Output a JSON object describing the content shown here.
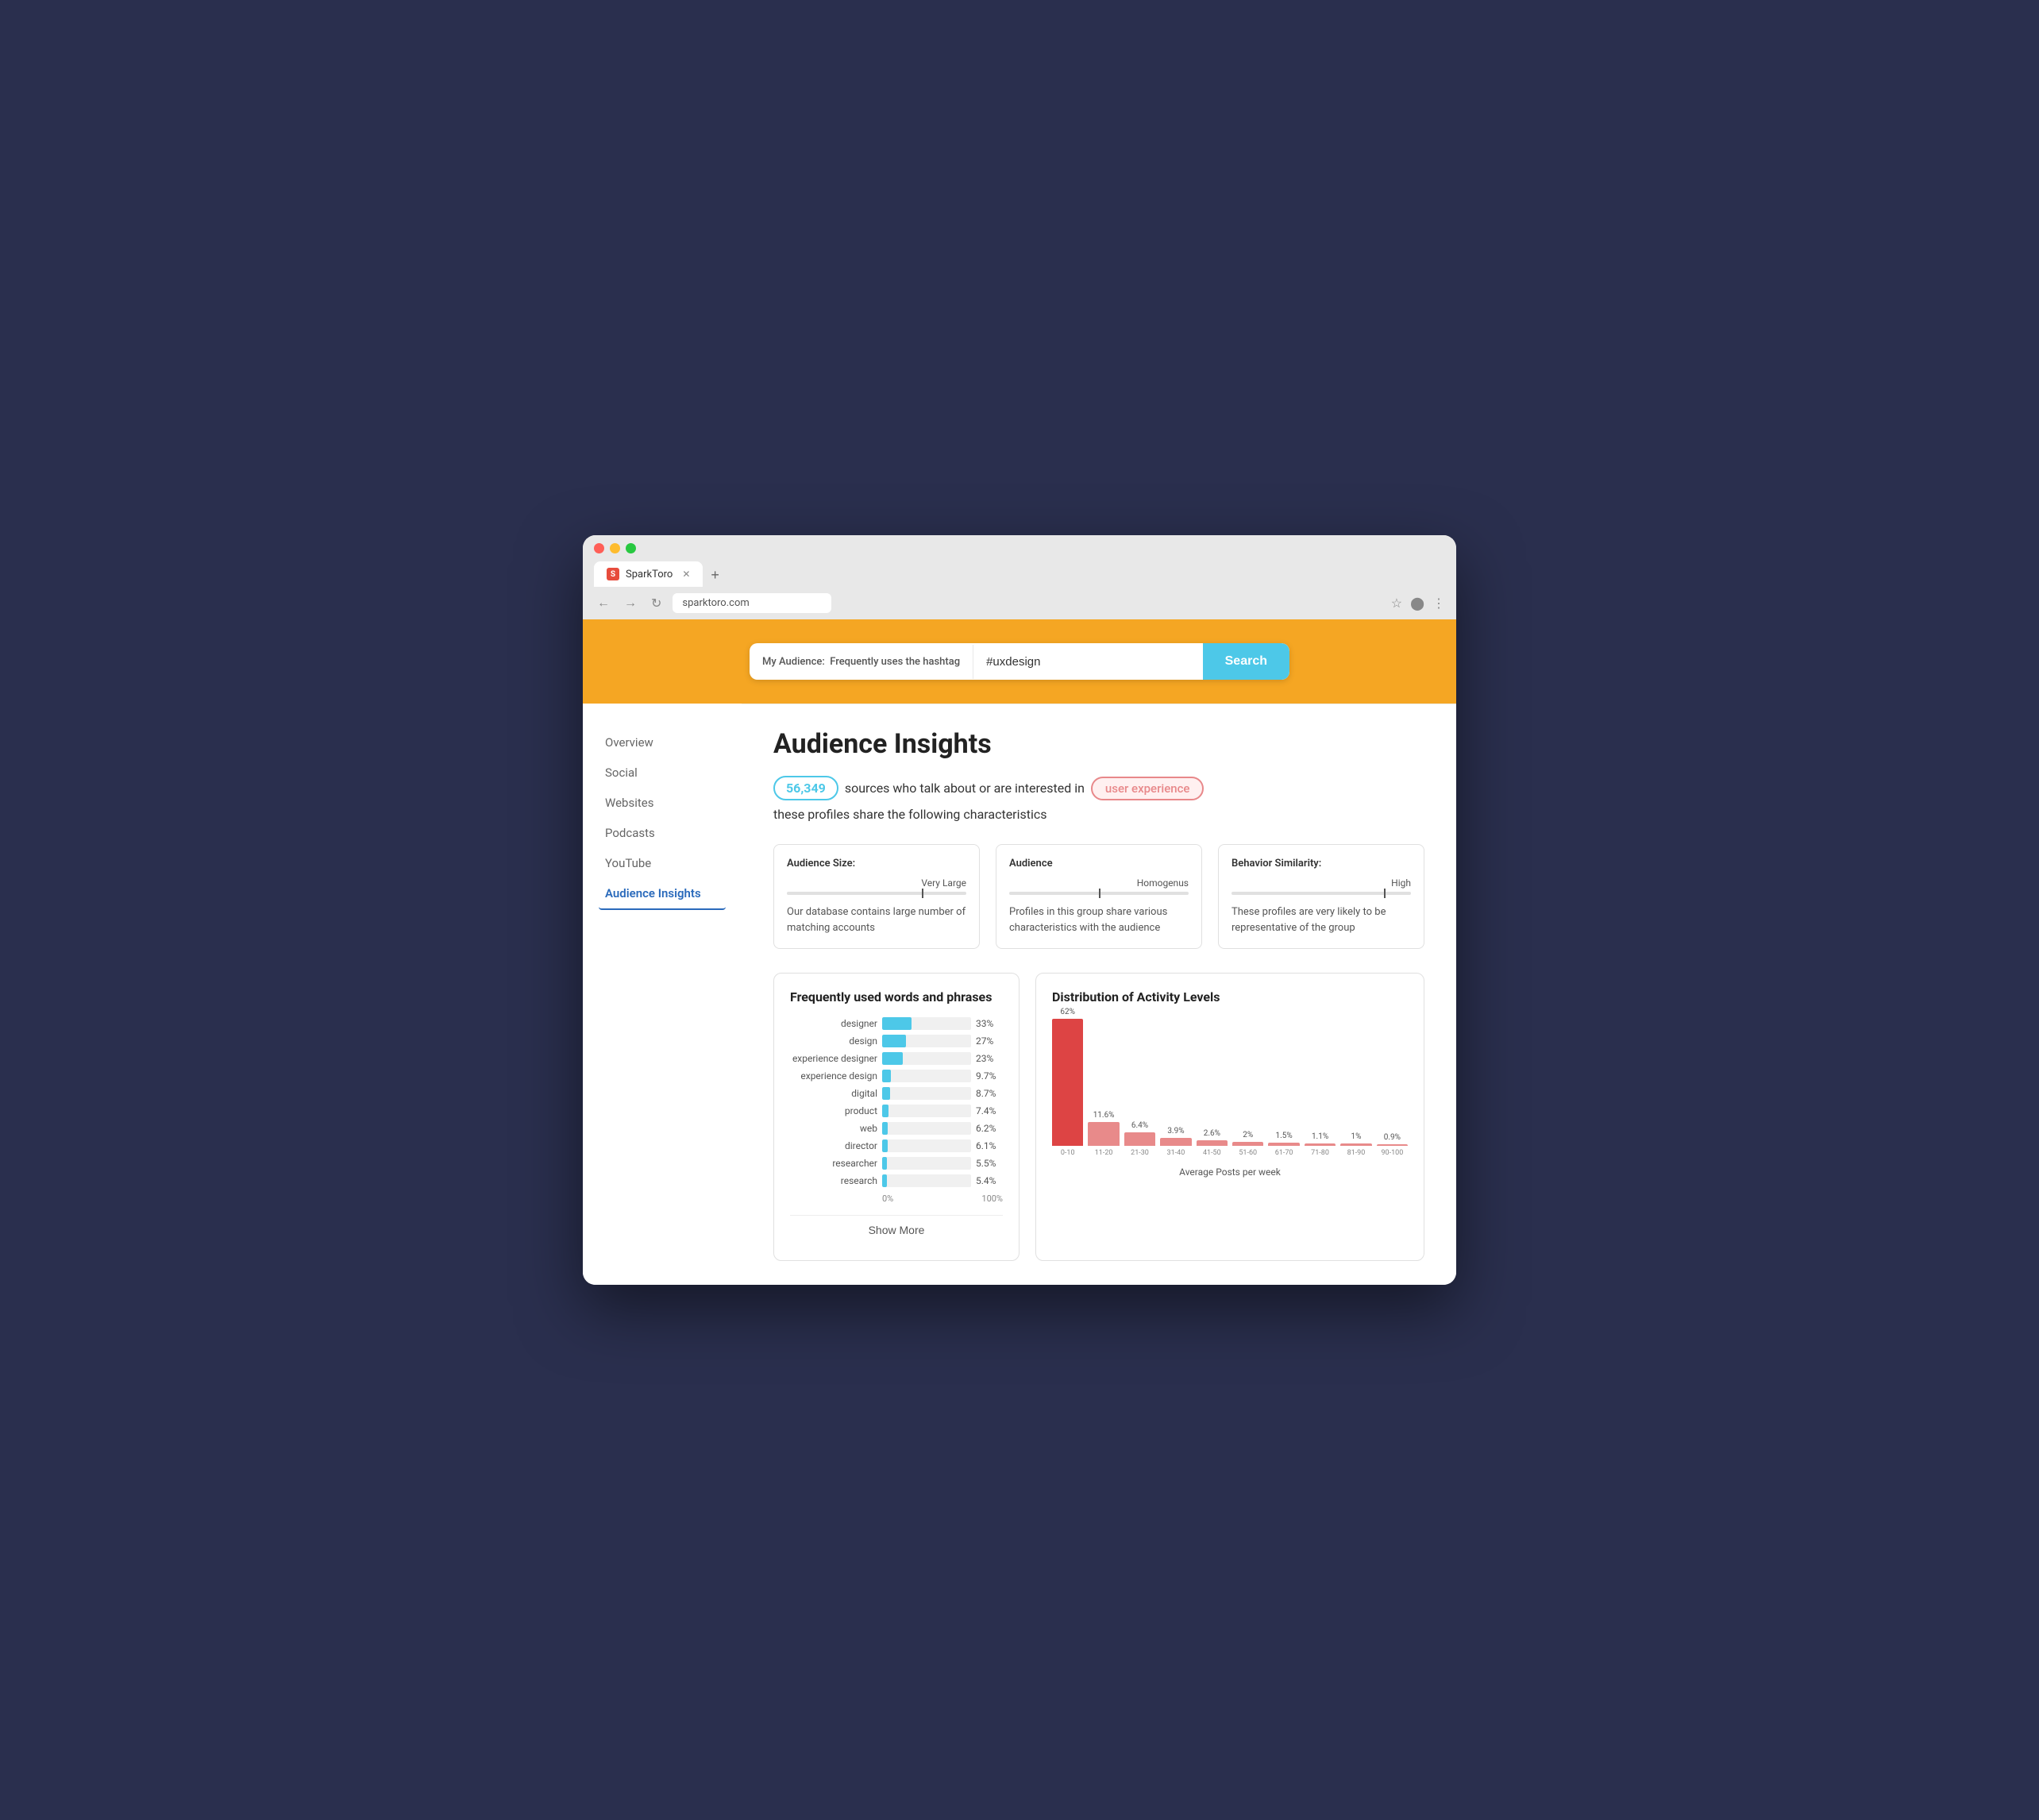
{
  "browser": {
    "tab_title": "SparkToro",
    "tab_favicon": "S",
    "address_bar_text": "sparktoro.com",
    "new_tab_icon": "+"
  },
  "search": {
    "label_prefix": "My Audience:",
    "label_type": "Frequently uses the hashtag",
    "query_value": "#uxdesign",
    "button_label": "Search"
  },
  "sidebar": {
    "items": [
      {
        "label": "Overview",
        "active": false
      },
      {
        "label": "Social",
        "active": false
      },
      {
        "label": "Websites",
        "active": false
      },
      {
        "label": "Podcasts",
        "active": false
      },
      {
        "label": "YouTube",
        "active": false
      },
      {
        "label": "Audience Insights",
        "active": true
      }
    ]
  },
  "main": {
    "page_title": "Audience Insights",
    "summary_count": "56,349",
    "summary_text_1": "sources who talk about or are interested in",
    "summary_topic": "user experience",
    "summary_text_2": "these profiles share the following characteristics",
    "metrics": [
      {
        "label": "Audience Size:",
        "scale_label": "Very Large",
        "indicator_pct": 75,
        "description": "Our database contains large number of matching accounts"
      },
      {
        "label": "Audience",
        "scale_label": "Homogenus",
        "indicator_pct": 50,
        "description": "Profiles in this group share various characteristics with the audience"
      },
      {
        "label": "Behavior Similarity:",
        "scale_label": "High",
        "indicator_pct": 85,
        "description": "These profiles are very likely to be representative of the group"
      }
    ],
    "words_chart": {
      "title": "Frequently used words and phrases",
      "bars": [
        {
          "label": "designer",
          "pct": 33,
          "display": "33%"
        },
        {
          "label": "design",
          "pct": 27,
          "display": "27%"
        },
        {
          "label": "experience designer",
          "pct": 23,
          "display": "23%"
        },
        {
          "label": "experience design",
          "pct": 9.7,
          "display": "9.7%"
        },
        {
          "label": "digital",
          "pct": 8.7,
          "display": "8.7%"
        },
        {
          "label": "product",
          "pct": 7.4,
          "display": "7.4%"
        },
        {
          "label": "web",
          "pct": 6.2,
          "display": "6.2%"
        },
        {
          "label": "director",
          "pct": 6.1,
          "display": "6.1%"
        },
        {
          "label": "researcher",
          "pct": 5.5,
          "display": "5.5%"
        },
        {
          "label": "research",
          "pct": 5.4,
          "display": "5.4%"
        }
      ],
      "axis_start": "0%",
      "axis_end": "100%",
      "show_more_label": "Show More"
    },
    "activity_chart": {
      "title": "Distribution of Activity Levels",
      "bars": [
        {
          "range": "0-10",
          "pct": 62,
          "display": "62%",
          "highlight": true
        },
        {
          "range": "11-20",
          "pct": 11.6,
          "display": "11.6%",
          "highlight": false
        },
        {
          "range": "21-30",
          "pct": 6.4,
          "display": "6.4%",
          "highlight": false
        },
        {
          "range": "31-40",
          "pct": 3.9,
          "display": "3.9%",
          "highlight": false
        },
        {
          "range": "41-50",
          "pct": 2.6,
          "display": "2.6%",
          "highlight": false
        },
        {
          "range": "51-60",
          "pct": 2,
          "display": "2%",
          "highlight": false
        },
        {
          "range": "61-70",
          "pct": 1.5,
          "display": "1.5%",
          "highlight": false
        },
        {
          "range": "71-80",
          "pct": 1.1,
          "display": "1.1%",
          "highlight": false
        },
        {
          "range": "81-90",
          "pct": 1,
          "display": "1%",
          "highlight": false
        },
        {
          "range": "90-100",
          "pct": 0.9,
          "display": "0.9%",
          "highlight": false
        }
      ],
      "axis_label": "Average Posts per week"
    }
  }
}
